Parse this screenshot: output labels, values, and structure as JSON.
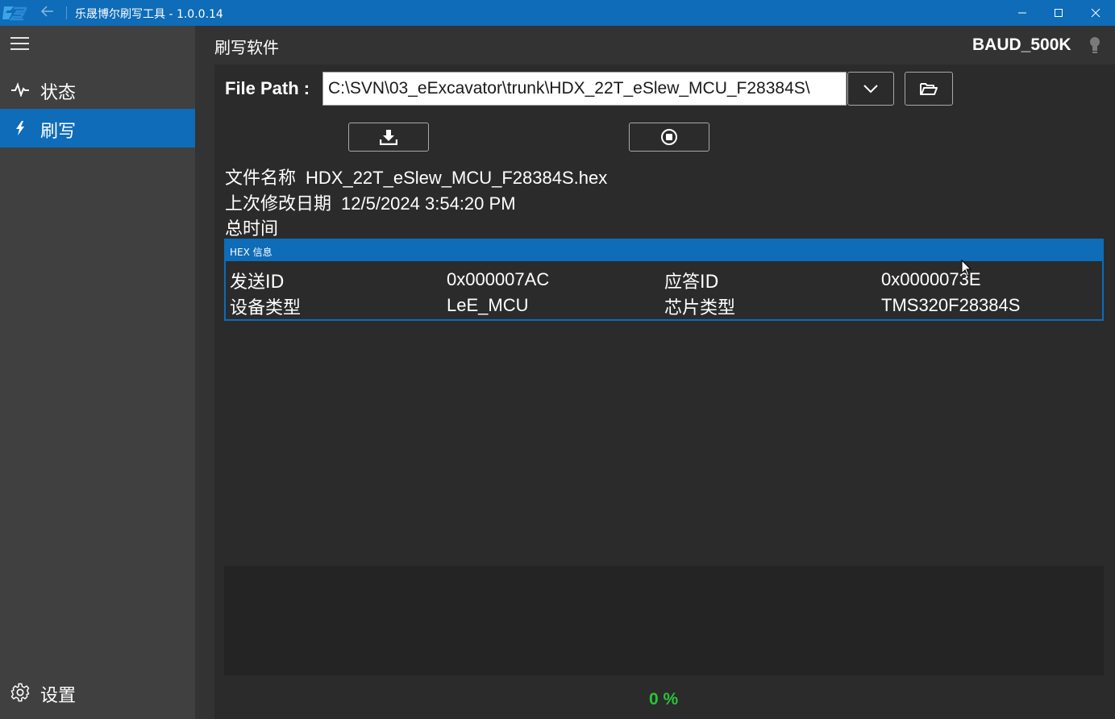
{
  "window": {
    "title": "乐晟博尔刷写工具 - 1.0.0.14",
    "accent_color": "#0e6cb8"
  },
  "sidebar": {
    "items": [
      {
        "label": "状态",
        "icon": "pulse-icon",
        "active": false
      },
      {
        "label": "刷写",
        "icon": "flash-icon",
        "active": true
      }
    ],
    "settings_label": "设置"
  },
  "header": {
    "page_title": "刷写软件",
    "baud": "BAUD_500K"
  },
  "file": {
    "path_label": "File Path :",
    "path_value": "C:\\SVN\\03_eExcavator\\trunk\\HDX_22T_eSlew_MCU_F28384S\\"
  },
  "info": {
    "filename_label": "文件名称",
    "filename_value": "HDX_22T_eSlew_MCU_F28384S.hex",
    "modified_label": "上次修改日期",
    "modified_value": "12/5/2024 3:54:20 PM",
    "total_time_label": "总时间"
  },
  "hex_info": {
    "title": "HEX 信息",
    "send_id_label": "发送ID",
    "send_id_value": "0x000007AC",
    "response_id_label": "应答ID",
    "response_id_value": "0x0000073E",
    "device_type_label": "设备类型",
    "device_type_value": "LeE_MCU",
    "chip_type_label": "芯片类型",
    "chip_type_value": "TMS320F28384S"
  },
  "progress": {
    "text": "0 %",
    "value": 0,
    "color": "#2bc437"
  }
}
